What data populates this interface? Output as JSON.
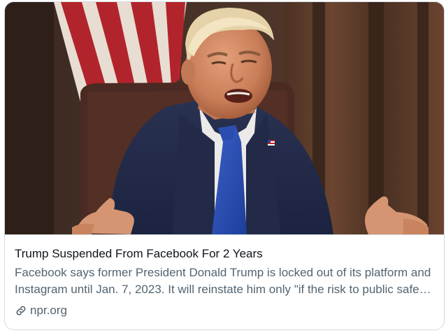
{
  "card": {
    "image_description_icon": "photo-thumbnail",
    "title": "Trump Suspended From Facebook For 2 Years",
    "description": "Facebook says former President Donald Trump is locked out of its platform and Instagram until Jan. 7, 2023. It will reinstate him only \"if the risk to public safety has receded.\"",
    "domain": "npr.org",
    "domain_icon": "link-icon"
  },
  "colors": {
    "border": "#cfd9de",
    "title": "#0f1419",
    "secondary_text": "#536471"
  }
}
